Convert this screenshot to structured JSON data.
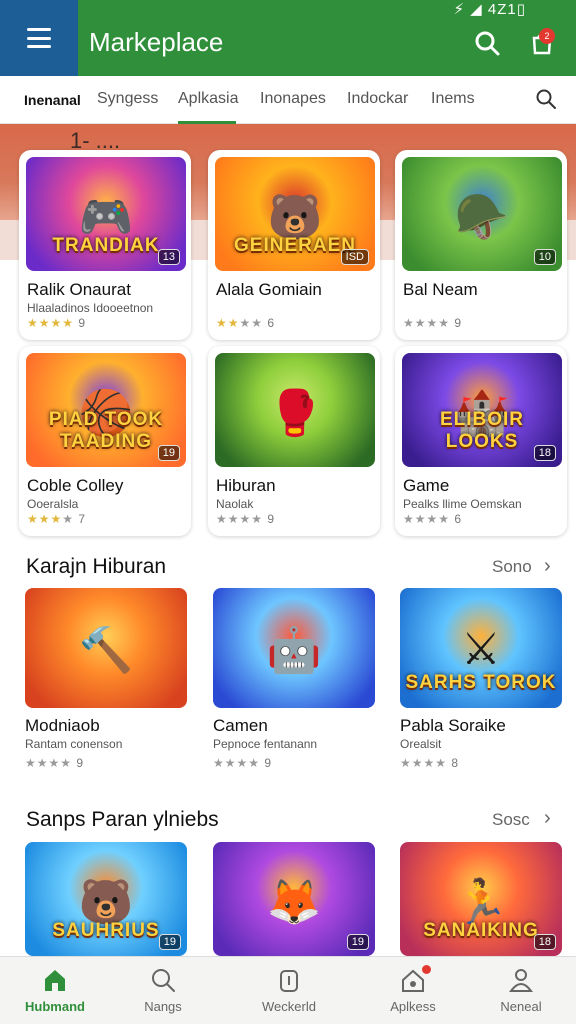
{
  "status_bar": {
    "text": "⚡ ◢ 4Z1▯"
  },
  "app": {
    "title": "Markeplace",
    "notification_count": "2"
  },
  "tabs": [
    {
      "label": "Inenanal",
      "active": false
    },
    {
      "label": "Syngess",
      "active": false
    },
    {
      "label": "Aplkasia",
      "active": true
    },
    {
      "label": "Inonapes",
      "active": false
    },
    {
      "label": "Indockar",
      "active": false
    },
    {
      "label": "Inems",
      "active": false
    }
  ],
  "hero": {
    "text": "1- ...."
  },
  "featured": [
    {
      "title": "Ralik Onaurat",
      "subtitle": "Hlaaladinos Idooeetnon",
      "rating": "9",
      "stars": 4,
      "art_text": "TRANDIAK",
      "badge": "13",
      "icon": "gamepad-icon",
      "colors": [
        "#6a2bc9",
        "#e0489b",
        "#ffb347"
      ]
    },
    {
      "title": "Alala Gomiain",
      "subtitle": "",
      "rating": "6",
      "stars": 2,
      "art_text": "GEINERAEN",
      "badge": "ISD",
      "icon": "bear-icon",
      "colors": [
        "#ff7a1a",
        "#ffb21c",
        "#d9362b"
      ]
    },
    {
      "title": "Bal Neam",
      "subtitle": "",
      "rating": "9",
      "stars": 0,
      "art_text": "",
      "badge": "10",
      "icon": "soldier-icon",
      "colors": [
        "#3b8d2f",
        "#7cc54a",
        "#3f7fcf"
      ]
    },
    {
      "title": "Coble Colley",
      "subtitle": "Ooeralsla",
      "rating": "7",
      "stars": 3,
      "art_text": "PIAD TOOK TAADING",
      "badge": "19",
      "icon": "ball-icon",
      "colors": [
        "#ff6b2b",
        "#ffb02e",
        "#7c3fe0"
      ]
    },
    {
      "title": "Hiburan",
      "subtitle": "Naolak",
      "rating": "9",
      "stars": 0,
      "art_text": "",
      "badge": "",
      "icon": "fighter-icon",
      "colors": [
        "#2c6b24",
        "#8fcf3c",
        "#c8e86a"
      ]
    },
    {
      "title": "Game",
      "subtitle": "Pealks llime Oemskan",
      "rating": "6",
      "stars": 0,
      "art_text": "ELIBOIR LOOKS",
      "badge": "18",
      "icon": "castle-icon",
      "colors": [
        "#3a1d8f",
        "#7d4ae6",
        "#ff9d3a"
      ]
    }
  ],
  "section1": {
    "title": "Karajn Hiburan",
    "more": "Sono",
    "items": [
      {
        "title": "Modniaob",
        "subtitle": "Rantam conenson",
        "rating": "9",
        "art_text": "",
        "badge": "",
        "icon": "hammer-icon",
        "colors": [
          "#d8421f",
          "#ff8a2a",
          "#ffcf56"
        ]
      },
      {
        "title": "Camen",
        "subtitle": "Pepnoce fentanann",
        "rating": "9",
        "art_text": "",
        "badge": "",
        "icon": "robot-icon",
        "colors": [
          "#2a4ad4",
          "#6ec6ff",
          "#ff5a3c"
        ]
      },
      {
        "title": "Pabla Soraike",
        "subtitle": "Orealsit",
        "rating": "8",
        "art_text": "SARHS TOROK",
        "badge": "",
        "icon": "viking-icon",
        "colors": [
          "#1c6fd1",
          "#5fc4ff",
          "#ffb03a"
        ]
      }
    ]
  },
  "section2": {
    "title": "Sanps Paran ylniebs",
    "more": "Sosc",
    "items": [
      {
        "art_text": "SAUHRIUS",
        "badge": "19",
        "icon": "bear-icon",
        "colors": [
          "#1c8be0",
          "#6fd0ff",
          "#ff8a2a"
        ]
      },
      {
        "art_text": "",
        "badge": "19",
        "icon": "squad-icon",
        "colors": [
          "#5b2bb8",
          "#b04ae0",
          "#ffb83a"
        ]
      },
      {
        "art_text": "SANAIKING",
        "badge": "18",
        "icon": "runner-icon",
        "colors": [
          "#b8305a",
          "#ff6a3c",
          "#ffcc4a"
        ]
      }
    ]
  },
  "bottom_nav": [
    {
      "label": "Hubmand",
      "active": true,
      "icon": "home-icon"
    },
    {
      "label": "Nangs",
      "active": false,
      "icon": "search-icon"
    },
    {
      "label": "Weckerld",
      "active": false,
      "icon": "window-icon"
    },
    {
      "label": "Aplkess",
      "active": false,
      "icon": "apps-home-icon"
    },
    {
      "label": "Neneal",
      "active": false,
      "icon": "profile-icon"
    }
  ],
  "colors": {
    "primary_green": "#2f8f3a",
    "menu_blue": "#1d5e96",
    "band_orange": "#d9694a",
    "star_gold": "#e2b73c"
  }
}
